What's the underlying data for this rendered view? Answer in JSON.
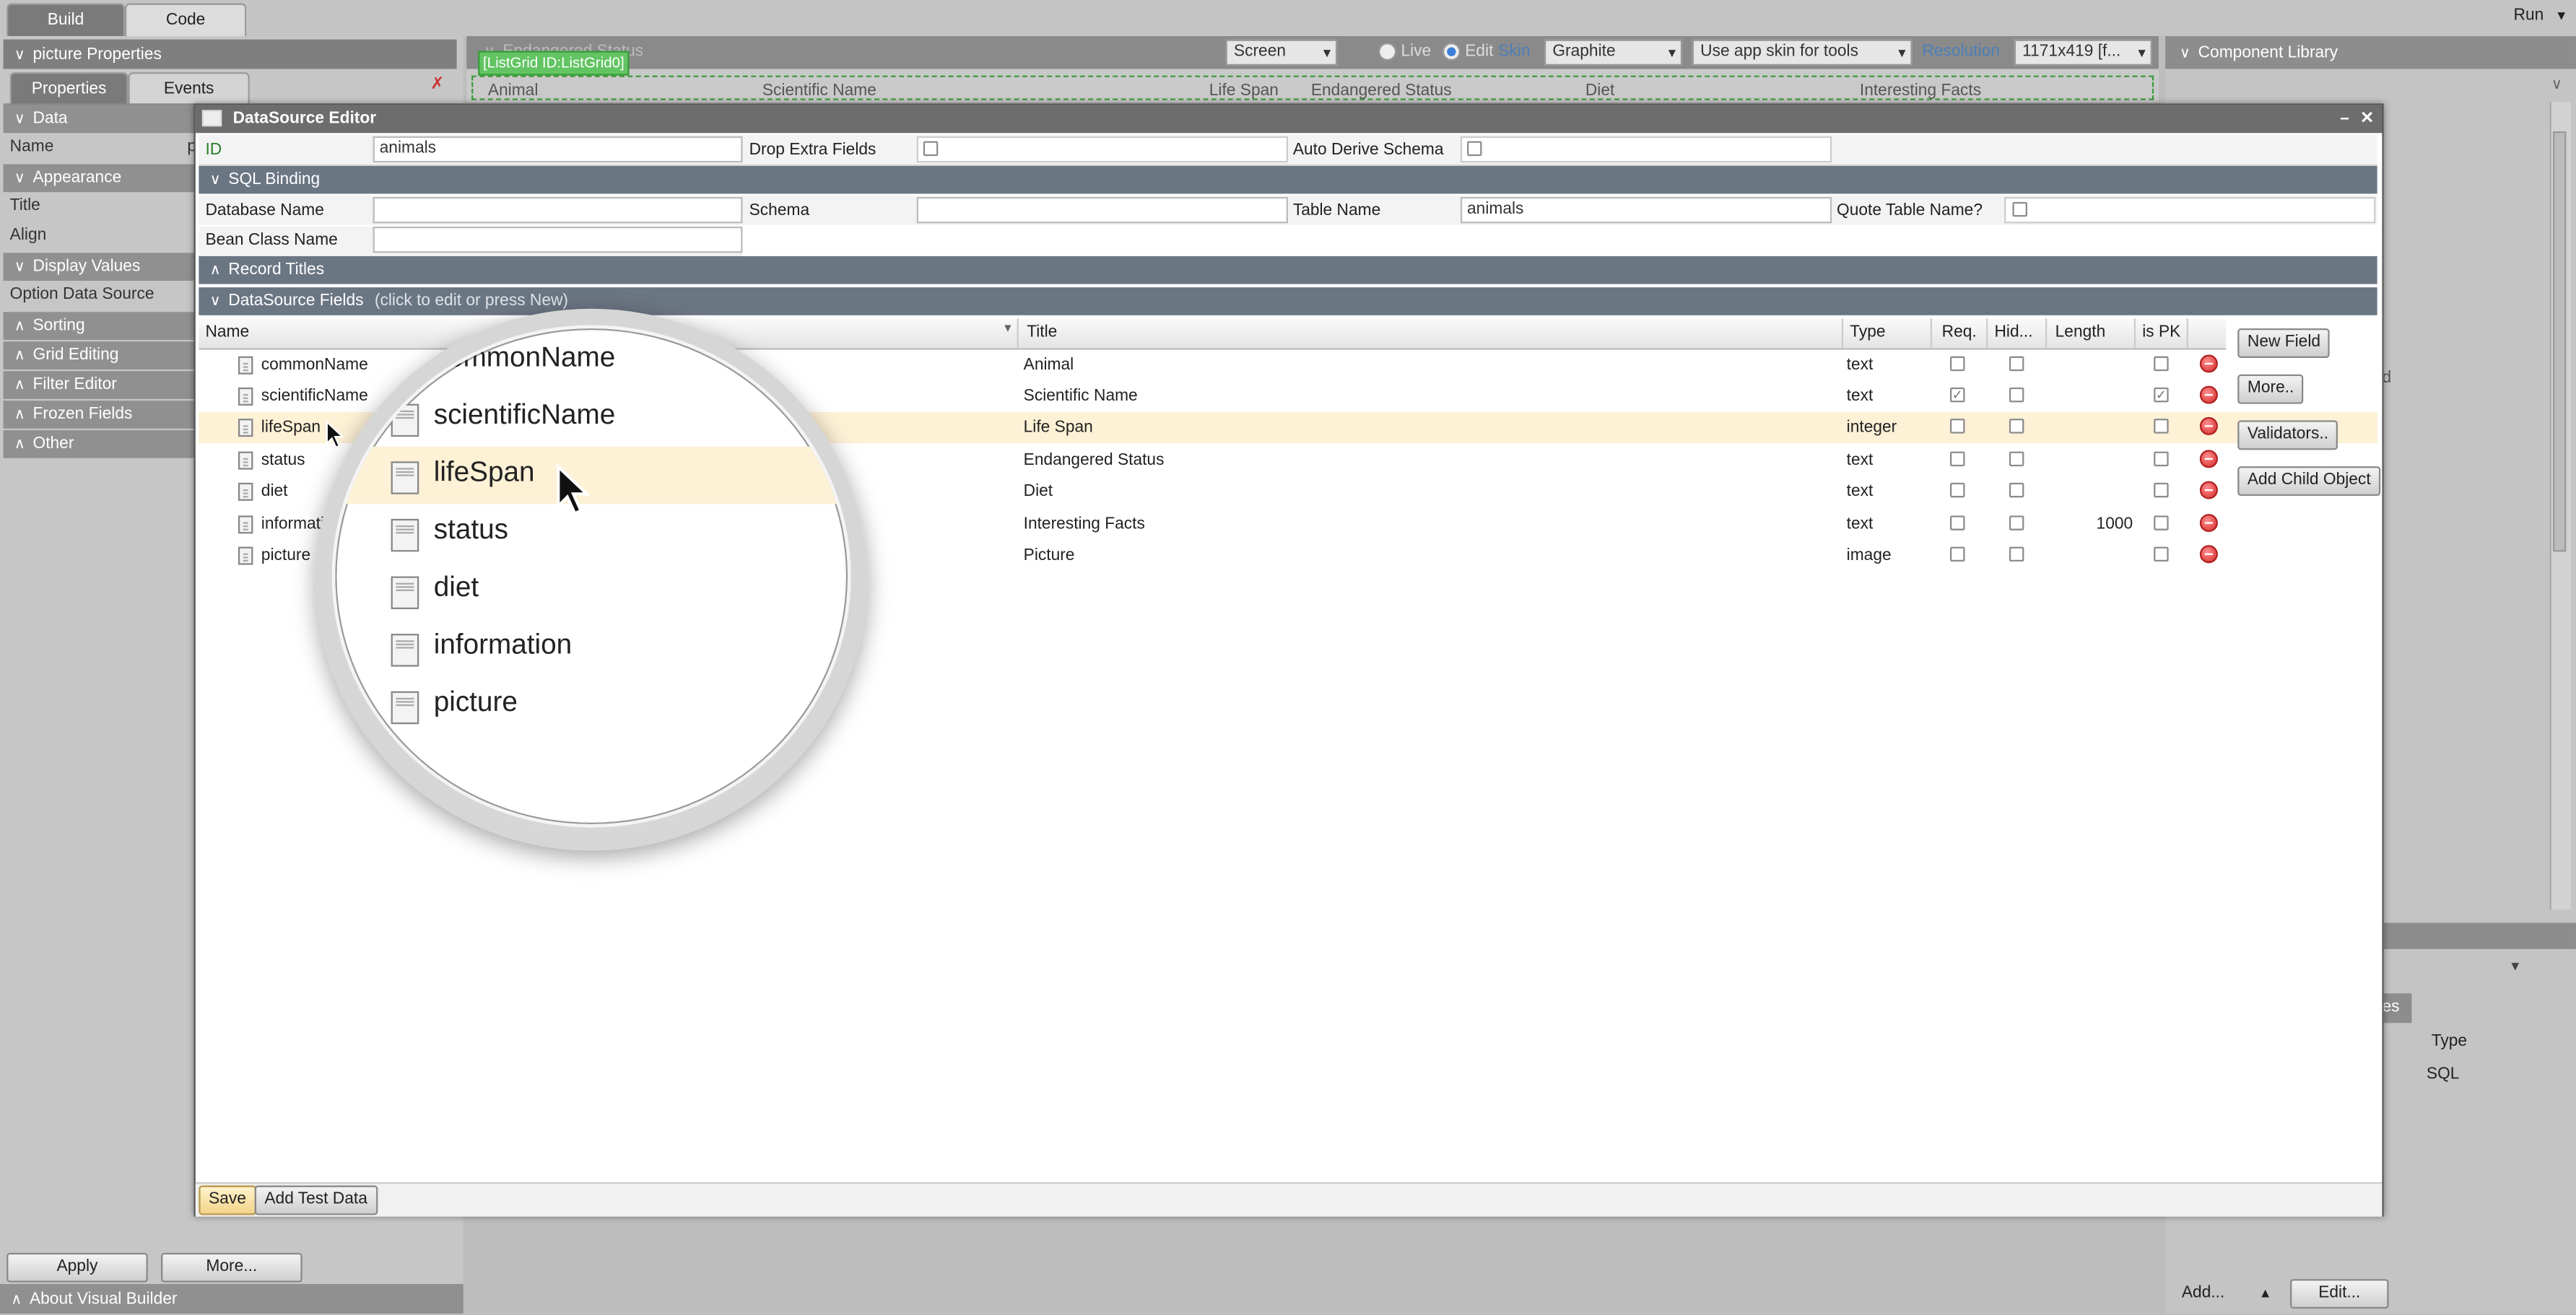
{
  "topbar": {
    "tab_build": "Build",
    "tab_code": "Code",
    "run": "Run"
  },
  "left": {
    "title": "picture Properties",
    "tab_properties": "Properties",
    "tab_events": "Events",
    "sections": [
      "Data",
      "Appearance",
      "Display Values",
      "Sorting",
      "Grid Editing",
      "Filter Editor",
      "Frozen Fields",
      "Other"
    ],
    "rows": {
      "name": "Name",
      "name_value": "p",
      "title": "Title",
      "align": "Align",
      "option_ds": "Option Data Source"
    },
    "apply": "Apply",
    "more": "More...",
    "about": "About Visual Builder"
  },
  "canvas": {
    "header": "Endangered Status",
    "screen_select": "Screen",
    "live": "Live",
    "edit": "Edit",
    "skin_label": "Skin",
    "skin_value": "Graphite",
    "tools_skin": "Use app skin for tools",
    "resolution_label": "Resolution",
    "resolution_value": "1171x419 [f...",
    "listgrid_tag": "[ListGrid ID:ListGrid0]",
    "columns": [
      "Animal",
      "Scientific Name",
      "Life Span",
      "Endangered Status",
      "Diet",
      "Interesting Facts"
    ]
  },
  "right": {
    "library": "Component Library",
    "partial_text": "d",
    "tab_fragment": "es",
    "col_type": "Type",
    "col_type_value": "SQL",
    "add": "Add...",
    "edit": "Edit..."
  },
  "dialog": {
    "title": "DataSource Editor",
    "id_label": "ID",
    "id_value": "animals",
    "drop_extra": "Drop Extra Fields",
    "auto_derive": "Auto Derive Schema",
    "sql_binding": "SQL Binding",
    "db_name": "Database Name",
    "schema": "Schema",
    "table_name": "Table Name",
    "table_value": "animals",
    "quote_table": "Quote Table Name?",
    "bean_class": "Bean Class Name",
    "record_titles": "Record Titles",
    "ds_fields": "DataSource Fields",
    "ds_fields_hint": "(click to edit or press New)",
    "grid_headers": {
      "name": "Name",
      "title": "Title",
      "type": "Type",
      "req": "Req.",
      "hid": "Hid...",
      "length": "Length",
      "pk": "is PK"
    },
    "fields": [
      {
        "name": "commonName",
        "title": "Animal",
        "type": "text",
        "req": false,
        "hid": false,
        "length": "",
        "pk": false
      },
      {
        "name": "scientificName",
        "title": "Scientific Name",
        "type": "text",
        "req": true,
        "hid": false,
        "length": "",
        "pk": true
      },
      {
        "name": "lifeSpan",
        "title": "Life Span",
        "type": "integer",
        "req": false,
        "hid": false,
        "length": "",
        "pk": false
      },
      {
        "name": "status",
        "title": "Endangered Status",
        "type": "text",
        "req": false,
        "hid": false,
        "length": "",
        "pk": false
      },
      {
        "name": "diet",
        "title": "Diet",
        "type": "text",
        "req": false,
        "hid": false,
        "length": "",
        "pk": false
      },
      {
        "name": "informatio",
        "title": "Interesting Facts",
        "type": "text",
        "req": false,
        "hid": false,
        "length": "1000",
        "pk": false
      },
      {
        "name": "picture",
        "title": "Picture",
        "type": "image",
        "req": false,
        "hid": false,
        "length": "",
        "pk": false
      }
    ],
    "buttons": {
      "new_field": "New Field",
      "more": "More..",
      "validators": "Validators..",
      "add_child": "Add Child Object"
    },
    "save": "Save",
    "add_test_data": "Add Test Data"
  },
  "magnifier": {
    "names": [
      "commonName",
      "scientificName",
      "lifeSpan",
      "status",
      "diet",
      "information",
      "picture"
    ]
  },
  "colors": {
    "highlight_row": "#fdf1d6",
    "dialog_title": "#6d6d6d",
    "section": "#6b7683",
    "green_id": "#2a7d2a"
  }
}
